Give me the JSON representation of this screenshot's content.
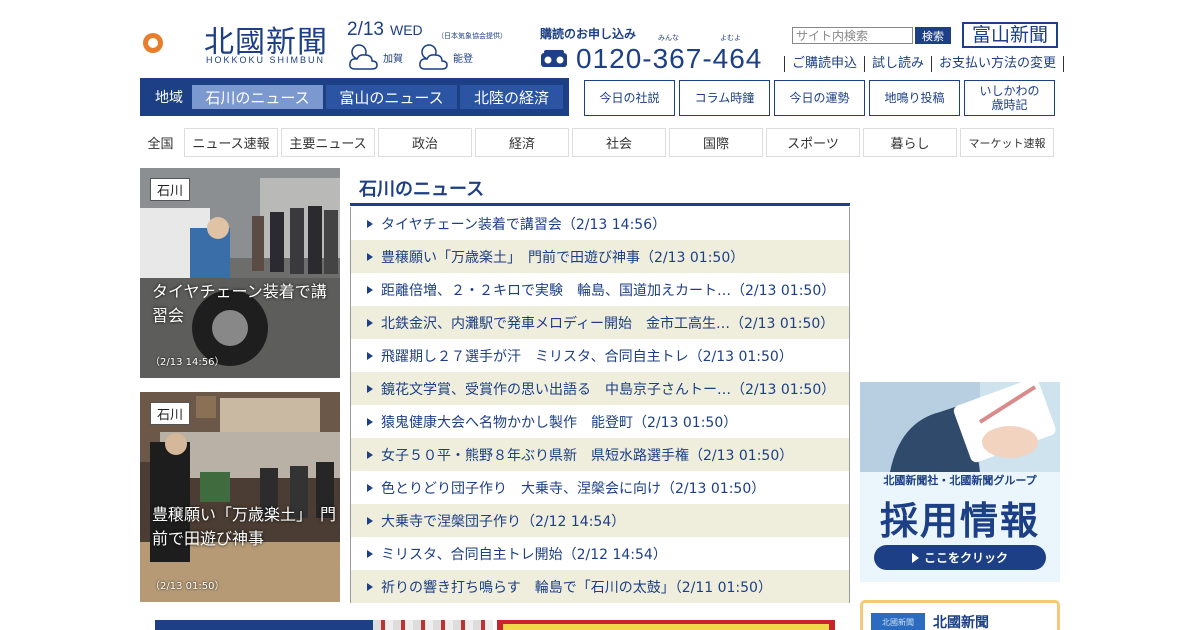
{
  "brand": {
    "name_jp": "北國新聞",
    "name_en": "HOKKOKU SHIMBUN",
    "brand_color": "#1c3f85"
  },
  "date": {
    "date": "2/13",
    "weekday": "WED",
    "weather_source": "（日本気象協会提供）",
    "weather": [
      {
        "area": "加賀",
        "icon": "cloudy-icon"
      },
      {
        "area": "能登",
        "icon": "cloudy-icon"
      }
    ]
  },
  "subscribe": {
    "title": "購読のお申し込み",
    "ruby_1": "みんな",
    "ruby_2": "よむよ",
    "phone": "0120-367-464",
    "icon": "phone-icon"
  },
  "search": {
    "placeholder": "サイト内検索",
    "button": "検索"
  },
  "toyama_logo": "富山新聞",
  "util_links": [
    "ご購読申込",
    "試し読み",
    "お支払い方法の変更"
  ],
  "region_nav": {
    "label": "地域",
    "tabs": [
      {
        "label": "石川のニュース",
        "active": true
      },
      {
        "label": "富山のニュース",
        "active": false
      },
      {
        "label": "北陸の経済",
        "active": false
      }
    ]
  },
  "feature_buttons": [
    "今日の社説",
    "コラム時鐘",
    "今日の運勢",
    "地鳴り投稿",
    "いしかわの\n歳時記"
  ],
  "category_nav": {
    "label": "全国",
    "items": [
      "ニュース速報",
      "主要ニュース",
      "政治",
      "経済",
      "社会",
      "国際",
      "スポーツ",
      "暮らし",
      "マーケット速報"
    ]
  },
  "photos": [
    {
      "tag": "石川",
      "caption": "タイヤチェーン装着で講習会",
      "time": "（2/13 14:56）"
    },
    {
      "tag": "石川",
      "caption": "豊穣願い「万歳楽土」　門前で田遊び神事",
      "time": "（2/13 01:50）"
    }
  ],
  "news": {
    "title": "石川のニュース",
    "items": [
      "タイヤチェーン装着で講習会（2/13 14:56）",
      "豊穣願い「万歳楽土」　門前で田遊び神事（2/13 01:50）",
      "距離倍増、２・２キロで実験　輪島、国道加えカート…（2/13 01:50）",
      "北鉄金沢、内灘駅で発車メロディー開始　金市工高生…（2/13 01:50）",
      "飛躍期し２７選手が汗　ミリスタ、合同自主トレ（2/13 01:50）",
      "鏡花文学賞、受賞作の思い出語る　中島京子さんトー…（2/13 01:50）",
      "猿鬼健康大会へ名物かかし製作　能登町（2/13 01:50）",
      "女子５０平・熊野８年ぶり県新　県短水路選手権（2/13 01:50）",
      "色とりどり団子作り　大乗寺、涅槃会に向け（2/13 01:50）",
      "大乗寺で涅槃団子作り（2/12 14:54）",
      "ミリスタ、合同自主トレ開始（2/12 14:54）",
      "祈りの響き打ち鳴らす　輪島で「石川の太鼓」（2/11 01:50）"
    ]
  },
  "recruit_ad": {
    "subtitle": "北國新聞社・北國新聞グループ",
    "title": "採用情報",
    "button": "ここをクリック"
  },
  "small_ad": {
    "logo": "北國新聞",
    "text": "北國新聞"
  }
}
